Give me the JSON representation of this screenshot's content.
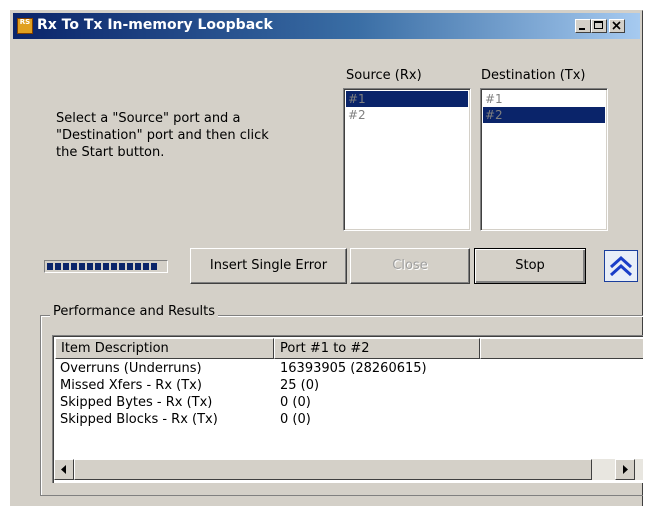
{
  "window": {
    "title": "Rx To Tx In-memory Loopback",
    "icon_label": "RS",
    "controls": [
      "minimize-icon",
      "maximize-icon",
      "close-icon"
    ]
  },
  "instructions": "Select a \"Source\" port and a\n\"Destination\" port and then click\nthe Start button.",
  "source": {
    "label": "Source (Rx)",
    "items": [
      "#1",
      "#2"
    ],
    "selected": "#1"
  },
  "destination": {
    "label": "Destination (Tx)",
    "items": [
      "#1",
      "#2"
    ],
    "selected": "#2"
  },
  "progress": {
    "level": 0.95
  },
  "buttons": {
    "insert_error": "Insert Single Error",
    "close": "Close",
    "stop": "Stop",
    "collapse_icon": "double-chevron-up-icon"
  },
  "results": {
    "group_label": "Performance and Results",
    "columns": [
      "Item Description",
      "Port #1 to #2",
      ""
    ],
    "rows": [
      [
        "Overruns (Underruns)",
        "16393905 (28260615)"
      ],
      [
        "Missed Xfers - Rx (Tx)",
        "25 (0)"
      ],
      [
        "Skipped Bytes - Rx (Tx)",
        "0 (0)"
      ],
      [
        "Skipped Blocks - Rx (Tx)",
        "0 (0)"
      ]
    ]
  },
  "colors": {
    "selection": "#0a246a",
    "title_start": "#0a246a",
    "title_end": "#a6caf0",
    "face": "#d4d0c8"
  }
}
